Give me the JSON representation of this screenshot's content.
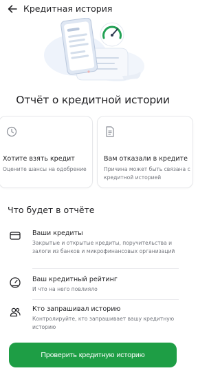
{
  "header": {
    "title": "Кредитная история",
    "back_icon": "arrow-left-icon"
  },
  "hero": {
    "illustration": "credit-report-illustration",
    "accent_color": "#1e9e45"
  },
  "report_title": "Отчёт о кредитной истории",
  "cards": [
    {
      "title": "Хотите взять кредит",
      "desc": "Оцените шансы на одобрение",
      "icon": "gauge-icon"
    },
    {
      "title": "Вам отказали в кредите",
      "desc": "Причина может быть связана с кредитной историей",
      "icon": "document-icon"
    }
  ],
  "section_title": "Что будет в отчёте",
  "features": [
    {
      "title": "Ваши кредиты",
      "desc": "Закрытые и открытые кредиты, поручительства и залоги из банков и микрофинансовых организаций",
      "icon": "card-icon"
    },
    {
      "title": "Ваш кредитный рейтинг",
      "desc": "И что на него повлияло",
      "icon": "speedometer-icon"
    },
    {
      "title": "Кто запрашивал историю",
      "desc": "Контролируйте, кто запрашивает вашу кредитную историю",
      "icon": "users-icon"
    }
  ],
  "cta": {
    "label": "Проверить кредитную историю",
    "color": "#1e9e45"
  }
}
